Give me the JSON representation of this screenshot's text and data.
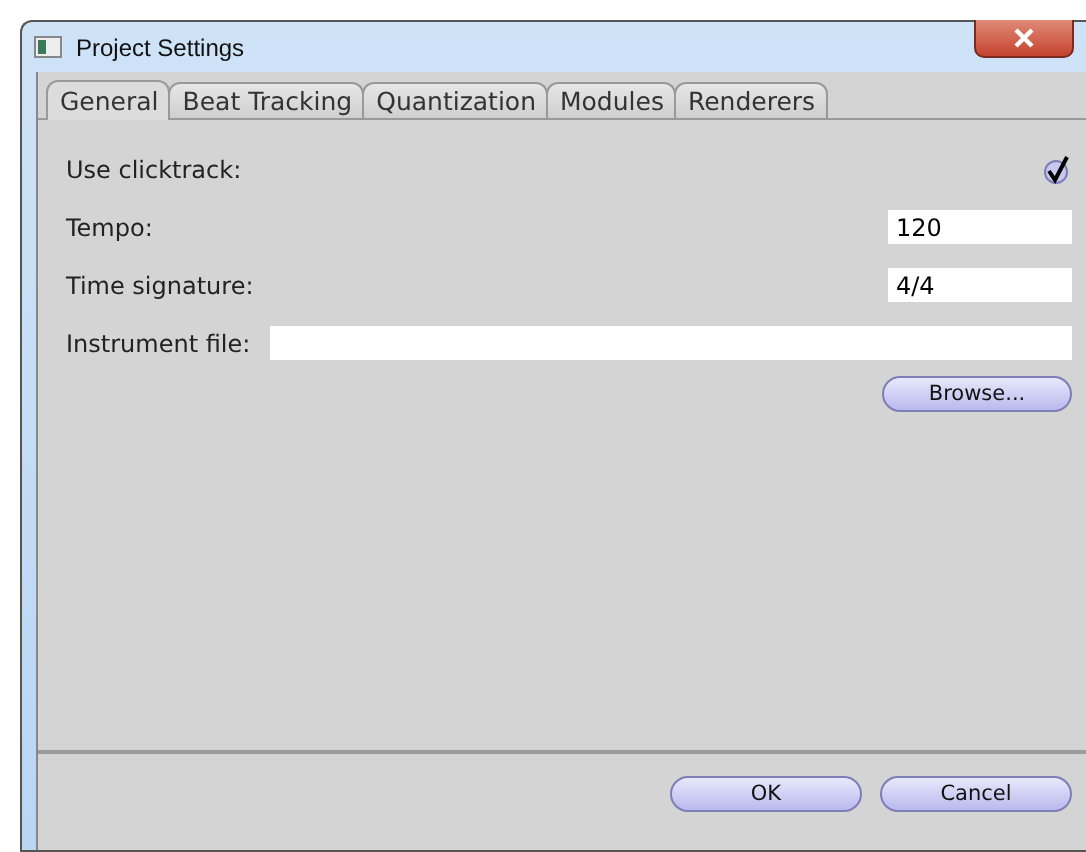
{
  "window": {
    "title": "Project Settings"
  },
  "tabs": [
    {
      "label": "General",
      "selected": true
    },
    {
      "label": "Beat Tracking",
      "selected": false
    },
    {
      "label": "Quantization",
      "selected": false
    },
    {
      "label": "Modules",
      "selected": false
    },
    {
      "label": "Renderers",
      "selected": false
    }
  ],
  "fields": [
    {
      "kind": "checkbox",
      "label": "Use clicktrack:",
      "checked": true
    },
    {
      "kind": "short",
      "label": "Tempo:",
      "value": "120"
    },
    {
      "kind": "short",
      "label": "Time signature:",
      "value": "4/4"
    },
    {
      "kind": "wide",
      "label": "Instrument file:"
    }
  ],
  "browse_button": "Browse...",
  "buttons": [
    "OK",
    "Cancel"
  ]
}
